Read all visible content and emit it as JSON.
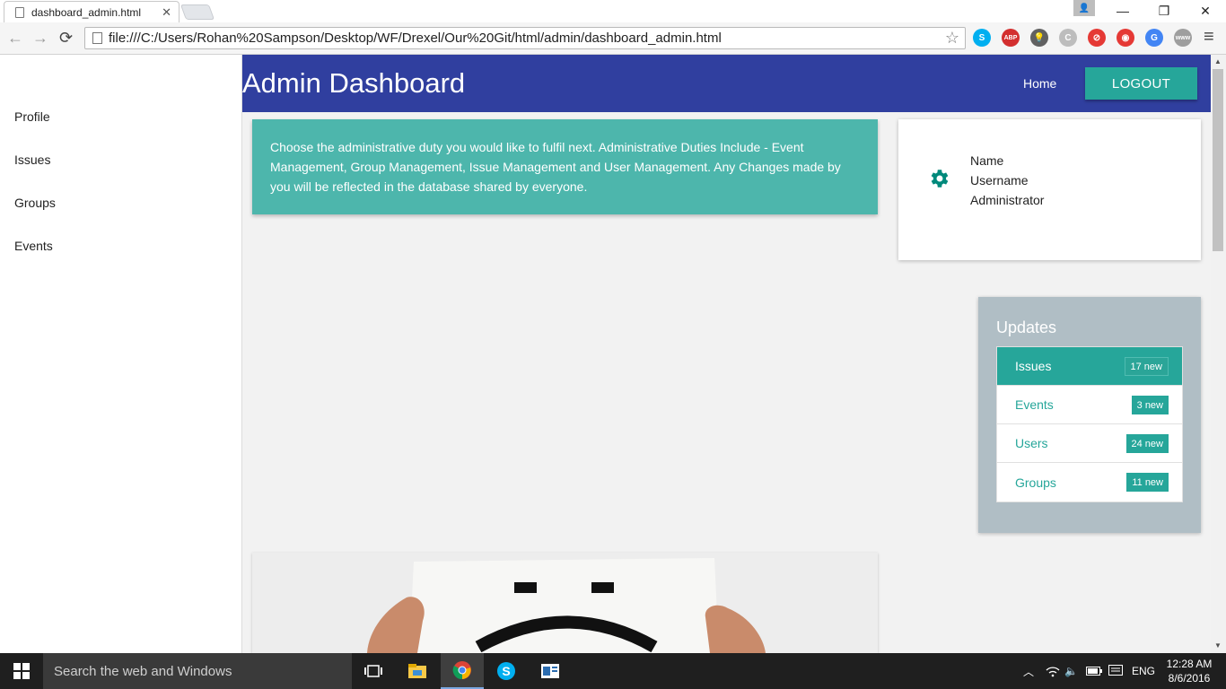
{
  "browser": {
    "tab_title": "dashboard_admin.html",
    "tab_close": "✕",
    "url": "file:///C:/Users/Rohan%20Sampson/Desktop/WF/Drexel/Our%20Git/html/admin/dashboard_admin.html",
    "back": "←",
    "forward": "→",
    "reload": "⟳",
    "star": "☆",
    "menu": "≡",
    "minimize": "—",
    "restore": "❐",
    "close": "✕",
    "user": "👤",
    "extensions": [
      {
        "name": "skype-extension-icon",
        "label": "S",
        "color": "#00aff0"
      },
      {
        "name": "adblock-plus-icon",
        "label": "ABP",
        "color": "#d32f2f"
      },
      {
        "name": "lightbulb-extension-icon",
        "label": "💡",
        "color": "#616161"
      },
      {
        "name": "refresh-extension-icon",
        "label": "C",
        "color": "#bdbdbd"
      },
      {
        "name": "block-site-icon",
        "label": "⊘",
        "color": "#e53935"
      },
      {
        "name": "record-extension-icon",
        "label": "◉",
        "color": "#e53935"
      },
      {
        "name": "google-translate-icon",
        "label": "G",
        "color": "#4285f4"
      },
      {
        "name": "www-extension-icon",
        "label": "www",
        "color": "#9e9e9e"
      }
    ]
  },
  "sidebar": {
    "items": [
      {
        "label": "Profile"
      },
      {
        "label": "Issues"
      },
      {
        "label": "Groups"
      },
      {
        "label": "Events"
      }
    ]
  },
  "header": {
    "title": "Admin Dashboard",
    "home": "Home",
    "logout": "LOGOUT"
  },
  "info": {
    "text": "Choose the administrative duty you would like to fulfil next. Administrative Duties Include - Event Management, Group Management, Issue Management and User Management. Any Changes made by you will be reflected in the database shared by everyone."
  },
  "profile": {
    "name": "Name",
    "username": "Username",
    "role": "Administrator"
  },
  "updates": {
    "title": "Updates",
    "items": [
      {
        "label": "Issues",
        "badge": "17 new"
      },
      {
        "label": "Events",
        "badge": "3 new"
      },
      {
        "label": "Users",
        "badge": "24 new"
      },
      {
        "label": "Groups",
        "badge": "11 new"
      }
    ]
  },
  "taskbar": {
    "search_placeholder": "Search the web and Windows",
    "language": "ENG",
    "time": "12:28 AM",
    "date": "8/6/2016"
  },
  "colors": {
    "header": "#303f9f",
    "accent": "#26a69a",
    "info_card": "#4db6ac",
    "updates_panel": "#b0bec5"
  }
}
